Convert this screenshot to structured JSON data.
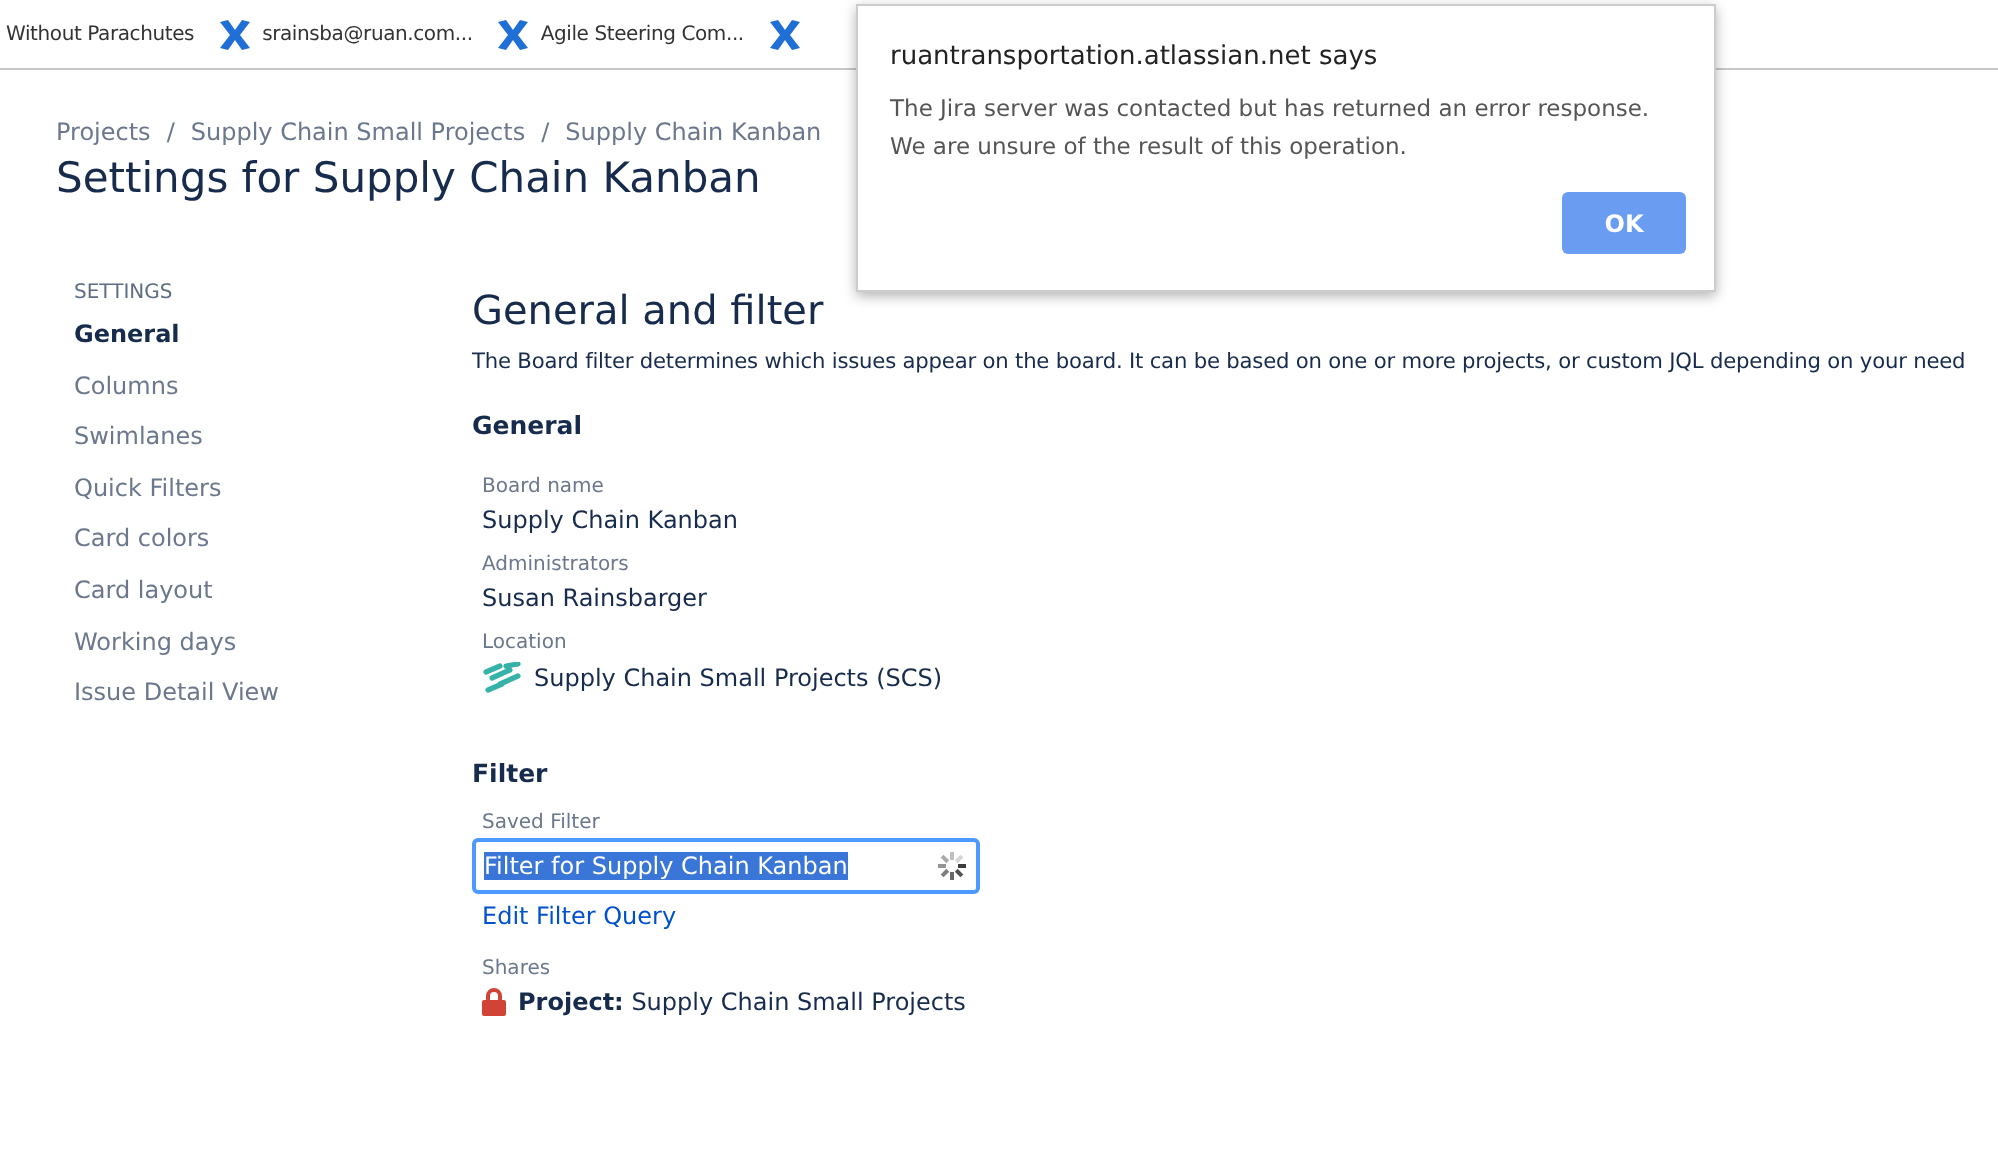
{
  "bookmarks": [
    {
      "label": "Without Parachutes",
      "icon": false
    },
    {
      "label": "srainsba@ruan.com...",
      "icon": true
    },
    {
      "label": "Agile Steering Com...",
      "icon": true
    }
  ],
  "breadcrumbs": [
    "Projects",
    "Supply Chain Small Projects",
    "Supply Chain Kanban"
  ],
  "breadcrumb_separator": "/",
  "page_title": "Settings for Supply Chain Kanban",
  "sidebar": {
    "heading": "SETTINGS",
    "items": [
      {
        "label": "General",
        "selected": true
      },
      {
        "label": "Columns",
        "selected": false
      },
      {
        "label": "Swimlanes",
        "selected": false
      },
      {
        "label": "Quick Filters",
        "selected": false
      },
      {
        "label": "Card colors",
        "selected": false
      },
      {
        "label": "Card layout",
        "selected": false
      },
      {
        "label": "Working days",
        "selected": false
      },
      {
        "label": "Issue Detail View",
        "selected": false
      }
    ]
  },
  "content": {
    "title": "General and filter",
    "description": "The Board filter determines which issues appear on the board. It can be based on one or more projects, or custom JQL depending on your need",
    "general": {
      "heading": "General",
      "fields": [
        {
          "label": "Board name",
          "value": "Supply Chain Kanban"
        },
        {
          "label": "Administrators",
          "value": "Susan Rainsbarger"
        }
      ],
      "location": {
        "label": "Location",
        "value": "Supply Chain Small Projects (SCS)"
      }
    },
    "filter": {
      "heading": "Filter",
      "saved_filter": {
        "label": "Saved Filter",
        "value": "Filter for Supply Chain Kanban",
        "text_selected": true,
        "loading": true
      },
      "edit_link": "Edit Filter Query",
      "shares": {
        "label": "Shares",
        "prefix": "Project:",
        "value": "Supply Chain Small Projects"
      }
    }
  },
  "dialog": {
    "title": "ruantransportation.atlassian.net says",
    "message": "The Jira server was contacted but has returned an error response. We are unsure of the result of this operation.",
    "button": "OK"
  }
}
